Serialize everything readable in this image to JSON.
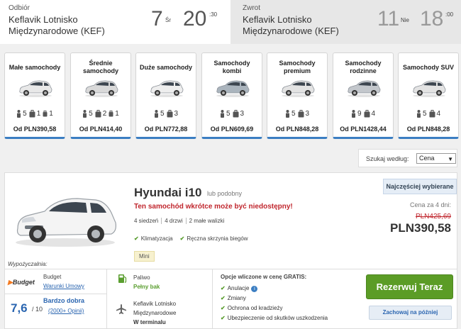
{
  "pickup": {
    "label": "Odbiór",
    "location_line1": "Keflavik Lotnisko",
    "location_line2": "Międzynarodowe (KEF)",
    "day": "7",
    "weekday": "Śr",
    "hour": "20",
    "minutes": ":30"
  },
  "return": {
    "label": "Zwrot",
    "location_line1": "Keflavik Lotnisko",
    "location_line2": "Międzynarodowe (KEF)",
    "day": "11",
    "weekday": "Nie",
    "hour": "18",
    "minutes": ":00"
  },
  "categories": [
    {
      "name": "Małe samochody",
      "seats": "5",
      "big_bags": "1",
      "small_bags": "1",
      "price": "Od PLN390,58",
      "car_color": "#e8e8e8"
    },
    {
      "name": "Średnie samochody",
      "seats": "5",
      "big_bags": "2",
      "small_bags": "1",
      "price": "Od PLN414,40",
      "car_color": "#d9d9d9"
    },
    {
      "name": "Duże samochody",
      "seats": "5",
      "bags": "3",
      "price": "Od PLN772,88",
      "car_color": "#eeeeee"
    },
    {
      "name": "Samochody kombi",
      "seats": "5",
      "bags": "3",
      "price": "Od PLN609,69",
      "car_color": "#aab4bd"
    },
    {
      "name": "Samochody premium",
      "seats": "5",
      "bags": "3",
      "price": "Od PLN848,28",
      "car_color": "#e3e3e3"
    },
    {
      "name": "Samochody rodzinne",
      "seats": "9",
      "bags": "4",
      "price": "Od PLN1428,44",
      "car_color": "#c3c7cc"
    },
    {
      "name": "Samochody SUV",
      "seats": "5",
      "bags": "4",
      "price": "Od PLN848,28",
      "car_color": "#e3e3e3"
    }
  ],
  "sort": {
    "label": "Szukaj według:",
    "selected": "Cena"
  },
  "offer": {
    "popular_badge": "Najczęściej wybierane",
    "car_name": "Hyundai i10",
    "similar": "lub podobny",
    "warning": "Ten samochód wkrótce może być niedostępny!",
    "features": [
      "4 siedzeń",
      "4 drzwi",
      "2 małe walizki"
    ],
    "equipment": [
      "Klimatyzacja",
      "Ręczna skrzynia biegów"
    ],
    "category_badge": "Mini",
    "supplier_caption": "Wypożyczalnia:",
    "price_days": "Cena za 4 dni:",
    "price_old": "PLN425,69",
    "price_new": "PLN390,58",
    "supplier": {
      "logo": "Budget",
      "label": "Budget",
      "terms_link": "Warunki Umowy"
    },
    "rating": {
      "score": "7,6",
      "scale": "/ 10",
      "label": "Bardzo dobra",
      "opinions": "(2000+ Opinii)"
    },
    "fuel": {
      "label": "Paliwo",
      "value": "Pełny bak"
    },
    "airport": {
      "line1": "Keflavik Lotnisko",
      "line2": "Międzynarodowe",
      "terminal": "W terminalu"
    },
    "included": {
      "title": "Opcje wliczone w cenę GRATIS:",
      "items": [
        "Anulacje",
        "Zmiany",
        "Ochrona od kradzieży",
        "Ubezpieczenie od skutków uszkodzenia"
      ]
    },
    "book_button": "Rezerwuj Teraz",
    "save_button": "Zachowaj na później"
  },
  "colors": {
    "accent_blue": "#3b7ec2",
    "book_green": "#5b9c26",
    "warning_red": "#c0262d"
  }
}
